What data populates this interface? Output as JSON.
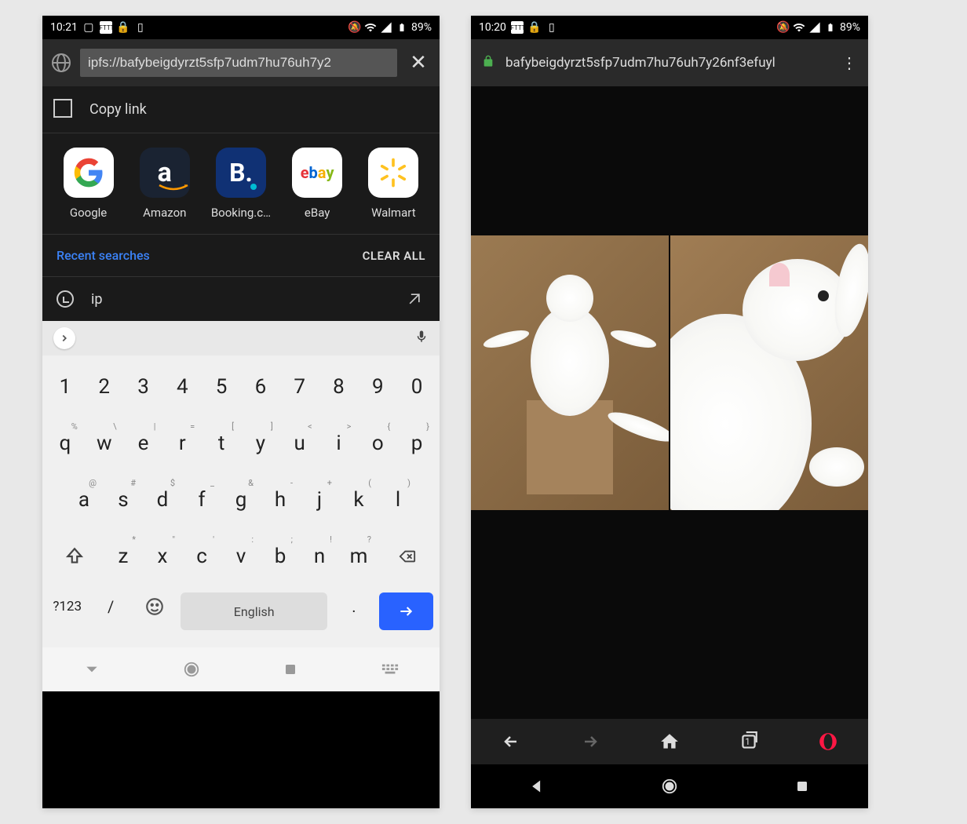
{
  "left": {
    "status": {
      "time": "10:21",
      "battery_pct": "89%"
    },
    "address_bar": {
      "url": "ipfs://bafybeigdyrzt5sfp7udm7hu76uh7y2"
    },
    "copy_link": {
      "label": "Copy link"
    },
    "tiles": [
      {
        "label": "Google"
      },
      {
        "label": "Amazon"
      },
      {
        "label": "Booking.c…"
      },
      {
        "label": "eBay"
      },
      {
        "label": "Walmart"
      }
    ],
    "recent": {
      "label": "Recent searches",
      "clear": "CLEAR ALL"
    },
    "history_item": {
      "text": "ip"
    },
    "keyboard": {
      "row1": [
        "1",
        "2",
        "3",
        "4",
        "5",
        "6",
        "7",
        "8",
        "9",
        "0"
      ],
      "row2": [
        {
          "k": "q",
          "s": "%"
        },
        {
          "k": "w",
          "s": "\\"
        },
        {
          "k": "e",
          "s": "|"
        },
        {
          "k": "r",
          "s": "="
        },
        {
          "k": "t",
          "s": "["
        },
        {
          "k": "y",
          "s": "]"
        },
        {
          "k": "u",
          "s": "<"
        },
        {
          "k": "i",
          "s": ">"
        },
        {
          "k": "o",
          "s": "{"
        },
        {
          "k": "p",
          "s": "}"
        }
      ],
      "row3": [
        {
          "k": "a",
          "s": "@"
        },
        {
          "k": "s",
          "s": "#"
        },
        {
          "k": "d",
          "s": "$"
        },
        {
          "k": "f",
          "s": "_"
        },
        {
          "k": "g",
          "s": "&"
        },
        {
          "k": "h",
          "s": "-"
        },
        {
          "k": "j",
          "s": "+"
        },
        {
          "k": "k",
          "s": "("
        },
        {
          "k": "l",
          "s": ")"
        }
      ],
      "row4": [
        {
          "k": "z",
          "s": "*"
        },
        {
          "k": "x",
          "s": "\""
        },
        {
          "k": "c",
          "s": "'"
        },
        {
          "k": "v",
          "s": ":"
        },
        {
          "k": "b",
          "s": ";"
        },
        {
          "k": "n",
          "s": "!"
        },
        {
          "k": "m",
          "s": "?"
        }
      ],
      "symbols_key": "?123",
      "slash_key": "/",
      "space_label": "English",
      "period_key": "."
    }
  },
  "right": {
    "status": {
      "time": "10:20",
      "battery_pct": "89%"
    },
    "address_bar": {
      "url": "bafybeigdyrzt5sfp7udm7hu76uh7y26nf3efuyl"
    },
    "browser_nav": {
      "tab_count": "1"
    }
  }
}
